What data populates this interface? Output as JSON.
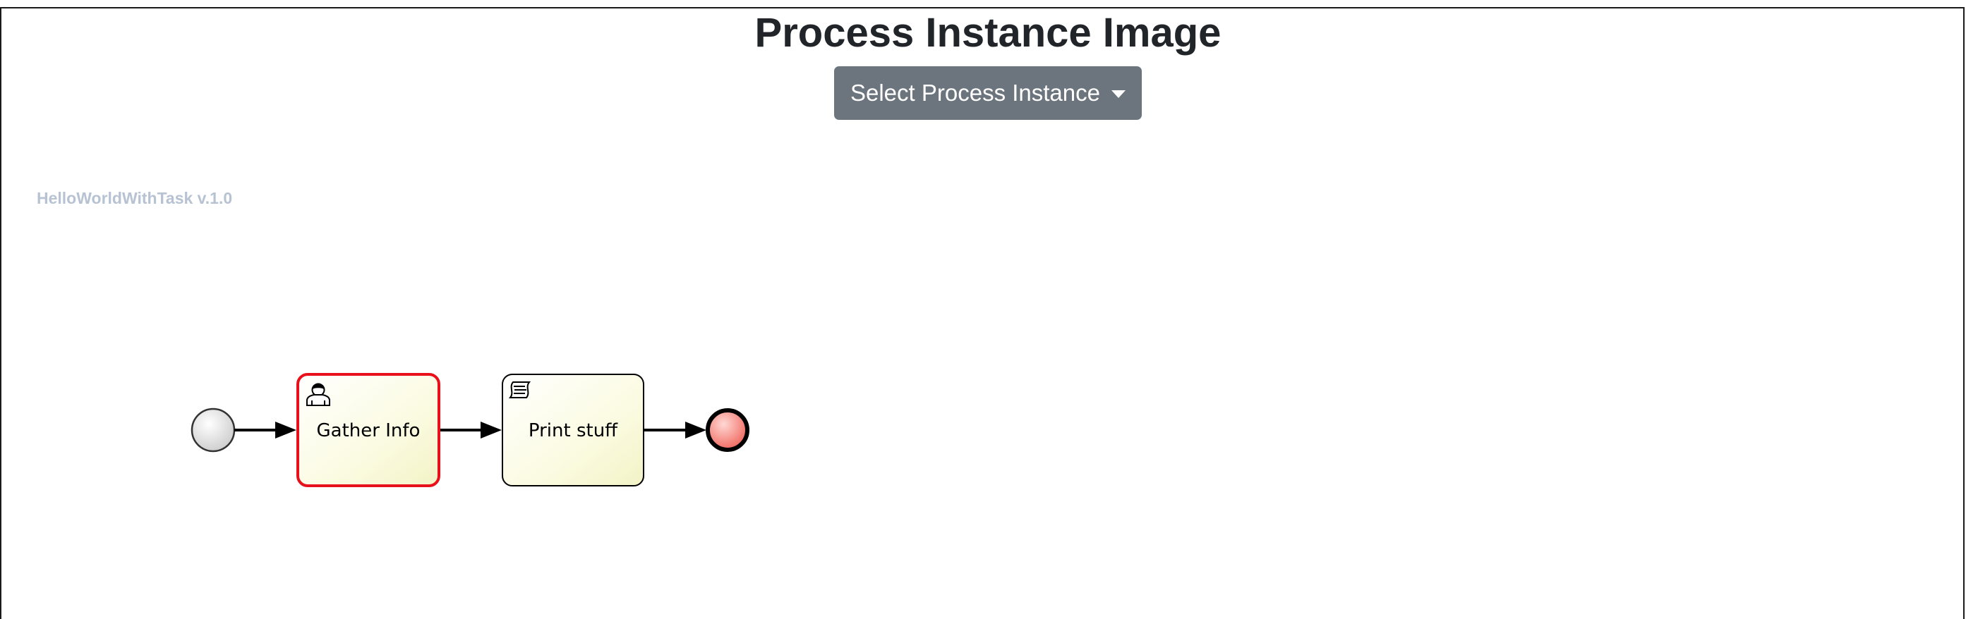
{
  "page": {
    "title": "Process Instance Image"
  },
  "toolbar": {
    "select_label": "Select Process Instance",
    "select_icon": "caret-down-icon"
  },
  "diagram": {
    "process_label": "HelloWorldWithTask v.1.0",
    "nodes": [
      {
        "id": "start",
        "kind": "start-event"
      },
      {
        "id": "gather",
        "kind": "user-task",
        "label": "Gather Info",
        "icon": "user-icon",
        "active": true
      },
      {
        "id": "print",
        "kind": "script-task",
        "label": "Print stuff",
        "icon": "script-icon",
        "active": false
      },
      {
        "id": "end",
        "kind": "end-event"
      }
    ],
    "colors": {
      "active_border": "#e8101a",
      "task_fill": "#fbfbe0",
      "start_fill": "#dddddd",
      "end_fill": "#f4736a"
    }
  }
}
